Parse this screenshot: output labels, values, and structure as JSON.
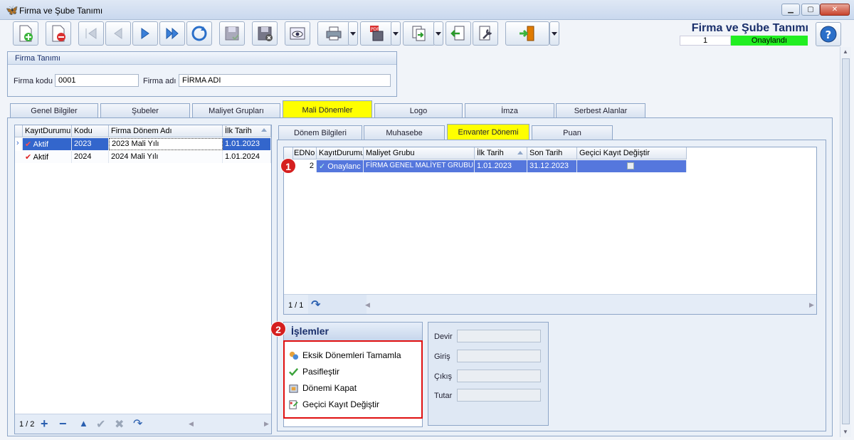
{
  "window": {
    "title": "Firma ve Şube Tanımı"
  },
  "header": {
    "title": "Firma ve Şube Tanımı",
    "record_no": "1",
    "status": "Onaylandı",
    "status_color": "#22ee22"
  },
  "firma_group": {
    "title": "Firma Tanımı",
    "kod_label": "Firma kodu",
    "kod_value": "0001",
    "adi_label": "Firma adı",
    "adi_value": "FİRMA ADI"
  },
  "main_tabs": [
    "Genel Bilgiler",
    "Şubeler",
    "Maliyet Grupları",
    "Mali Dönemler",
    "Logo",
    "İmza",
    "Serbest Alanlar"
  ],
  "left_grid": {
    "columns": [
      "KayıtDurumu",
      "Kodu",
      "Firma Dönem Adı",
      "İlk Tarih"
    ],
    "rows": [
      [
        "Aktif",
        "2023",
        "2023 Mali Yılı",
        "1.01.2023"
      ],
      [
        "Aktif",
        "2024",
        "2024 Mali Yılı",
        "1.01.2024"
      ]
    ],
    "pager": "1 / 2"
  },
  "sub_tabs": [
    "Dönem Bilgileri",
    "Muhasebe",
    "Envanter Dönemi",
    "Puan"
  ],
  "right_grid": {
    "columns": [
      "EDNo",
      "KayıtDurumu",
      "Maliyet Grubu",
      "İlk Tarih",
      "Son Tarih",
      "Geçici Kayıt Değiştir"
    ],
    "rows": [
      [
        "2",
        "Onaylanc",
        "FİRMA GENEL MALİYET GRUBU",
        "1.01.2023",
        "31.12.2023",
        ""
      ]
    ],
    "pager": "1 / 1"
  },
  "badges": {
    "one": "1",
    "two": "2"
  },
  "islemler": {
    "title": "İşlemler",
    "items": [
      "Eksik Dönemleri Tamamla",
      "Pasifleştir",
      "Dönemi Kapat",
      "Geçici Kayıt Değiştir"
    ]
  },
  "devir_panel": {
    "labels": [
      "Devir",
      "Giriş",
      "Çıkış",
      "Tutar"
    ]
  },
  "colors": {
    "accent": "#3366cc",
    "tab_active": "#ffff00",
    "badge": "#d51f1f",
    "highlight": "#e01010"
  }
}
